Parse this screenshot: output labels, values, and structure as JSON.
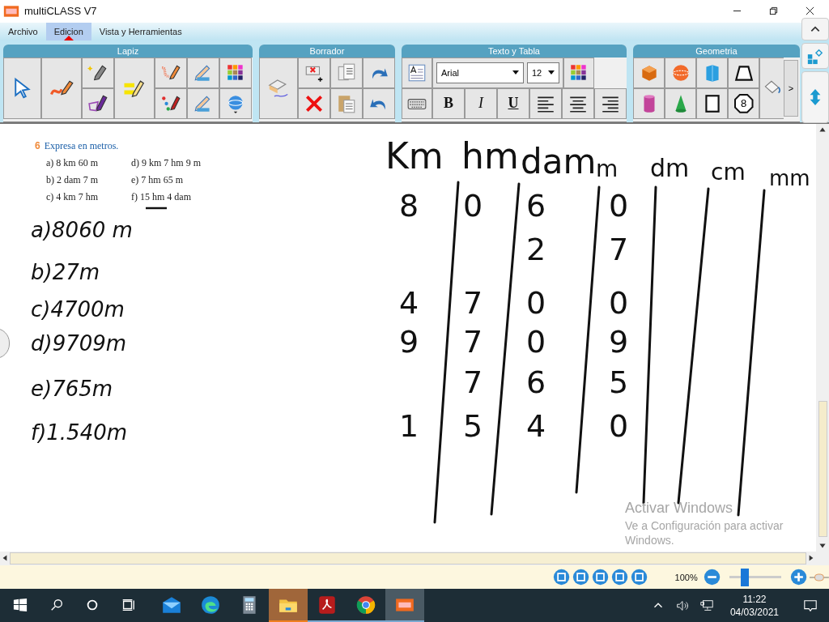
{
  "window": {
    "title": "multiCLASS V7"
  },
  "menu": [
    {
      "label": "Archivo",
      "selected": false
    },
    {
      "label": "Edicion",
      "selected": true
    },
    {
      "label": "Vista y Herramientas",
      "selected": false
    }
  ],
  "ribbon": {
    "groups": [
      "Lapiz",
      "Borrador",
      "Texto y Tabla",
      "Geometria"
    ],
    "font": "Arial",
    "font_size": "12",
    "format_buttons": [
      "B",
      "I",
      "U"
    ],
    "octagon_label": "8",
    "more_button": ">"
  },
  "exercise": {
    "number": "6",
    "title": "Expresa en metros.",
    "items": [
      "a) 8 km 60 m",
      "b) 2 dam 7 m",
      "c) 4 km 7 hm",
      "d) 9 km 7 hm 9 m",
      "e) 7 hm 65 m",
      "f) 15 hm 4 dam"
    ]
  },
  "handwriting": {
    "answers": [
      "a)8060 m",
      "b)27m",
      "c)4700m",
      "d)9709m",
      "e)765m",
      "f)1.540m"
    ],
    "headers": [
      "Km",
      "hm",
      "dam",
      "m",
      "dm",
      "cm",
      "mm"
    ],
    "rows": [
      [
        "8",
        "0",
        "6",
        "0"
      ],
      [
        null,
        null,
        "2",
        "7"
      ],
      [
        "4",
        "7",
        "0",
        "0"
      ],
      [
        "9",
        "7",
        "0",
        "9"
      ],
      [
        null,
        "7",
        "6",
        "5"
      ],
      [
        "1",
        "5",
        "4",
        "0"
      ]
    ]
  },
  "activation": {
    "title": "Activar Windows",
    "text": "Ve a Configuración para activar Windows."
  },
  "zoom": {
    "reading": "100%",
    "level": 0.3
  },
  "taskbar": {
    "apps": [
      {
        "kind": "mail",
        "highlighted": false,
        "running": false,
        "selected": false
      },
      {
        "kind": "edge",
        "highlighted": false,
        "running": false,
        "selected": false
      },
      {
        "kind": "calculator",
        "highlighted": false,
        "running": false,
        "selected": false
      },
      {
        "kind": "folder",
        "highlighted": true,
        "running": true,
        "selected": false
      },
      {
        "kind": "pdf",
        "highlighted": false,
        "running": true,
        "selected": false
      },
      {
        "kind": "chrome",
        "highlighted": false,
        "running": true,
        "selected": false
      },
      {
        "kind": "multiclass",
        "highlighted": false,
        "running": true,
        "selected": true
      }
    ],
    "time": "11:22",
    "date": "04/03/2021"
  }
}
